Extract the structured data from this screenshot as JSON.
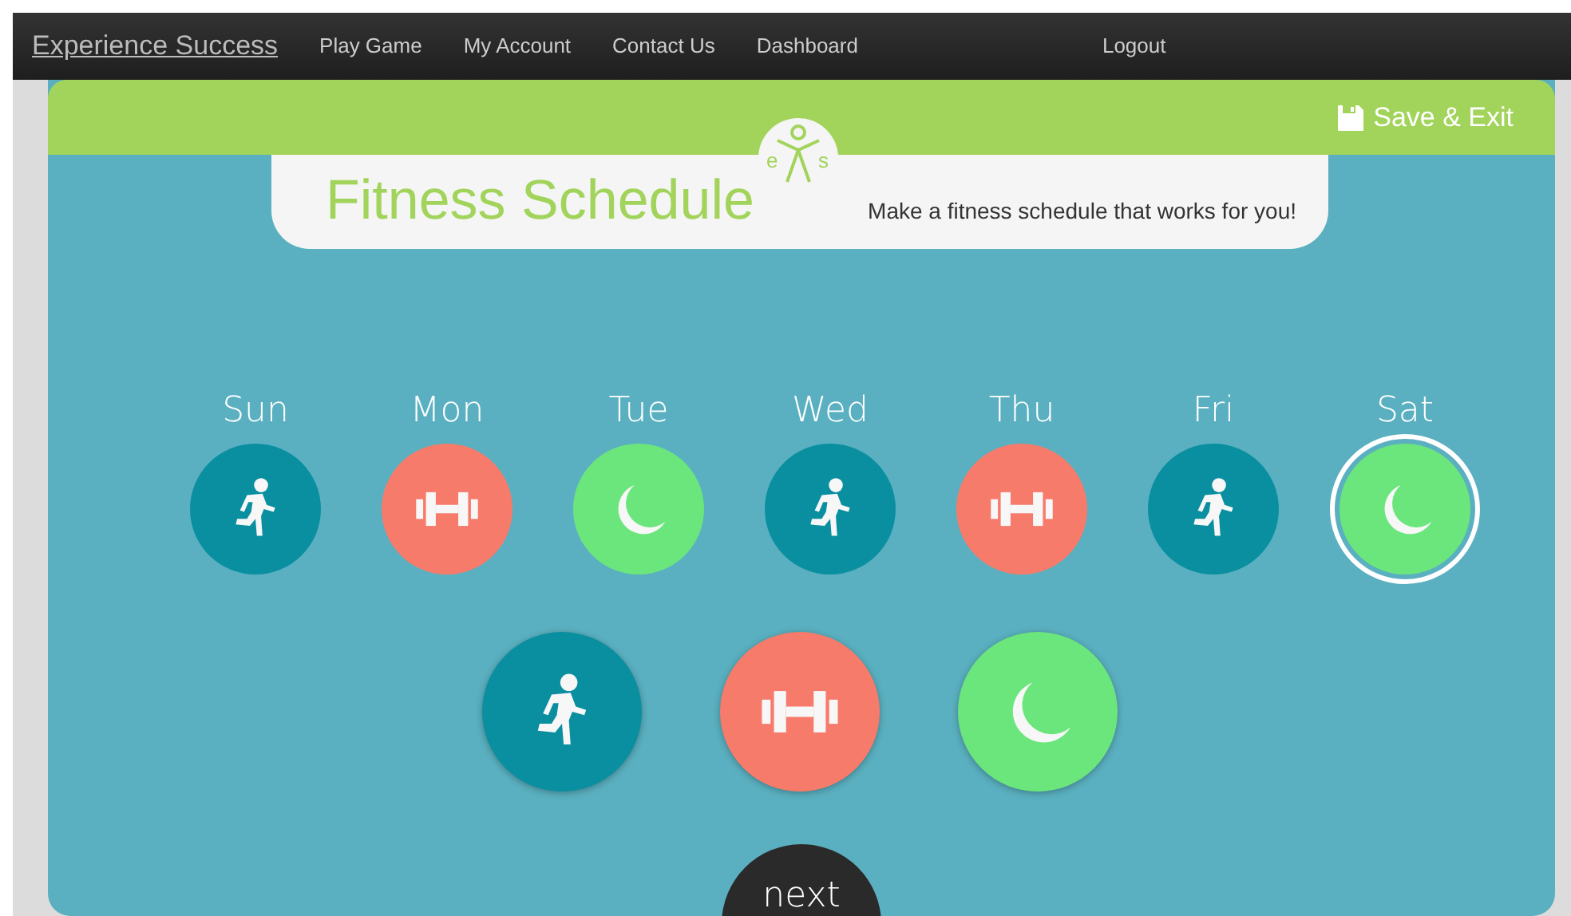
{
  "navbar": {
    "brand": "Experience Success",
    "links": [
      {
        "label": "Play Game",
        "kind": "main"
      },
      {
        "label": "My Account",
        "kind": "main"
      },
      {
        "label": "Contact Us",
        "kind": "main"
      },
      {
        "label": "Dashboard",
        "kind": "main"
      },
      {
        "label": "Logout",
        "kind": "far"
      }
    ]
  },
  "header": {
    "save_button": "Save & Exit"
  },
  "banner": {
    "title": "Fitness Schedule",
    "subtitle": "Make a fitness schedule that works for you!",
    "logo": {
      "left_letter": "e",
      "right_letter": "s"
    }
  },
  "days": [
    {
      "label": "Sun",
      "kind": "run",
      "selected": false
    },
    {
      "label": "Mon",
      "kind": "lift",
      "selected": false
    },
    {
      "label": "Tue",
      "kind": "rest",
      "selected": false
    },
    {
      "label": "Wed",
      "kind": "run",
      "selected": false
    },
    {
      "label": "Thu",
      "kind": "lift",
      "selected": false
    },
    {
      "label": "Fri",
      "kind": "run",
      "selected": false
    },
    {
      "label": "Sat",
      "kind": "rest",
      "selected": true
    }
  ],
  "activities": [
    {
      "kind": "run"
    },
    {
      "kind": "lift"
    },
    {
      "kind": "rest"
    }
  ],
  "next_button": "next"
}
